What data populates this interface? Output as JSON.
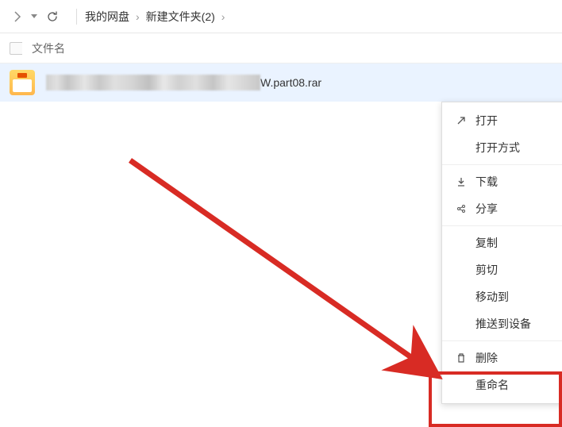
{
  "topbar": {
    "breadcrumbs": [
      "我的网盘",
      "新建文件夹(2)"
    ]
  },
  "columns": {
    "filename_label": "文件名"
  },
  "file": {
    "visible_suffix": "W.part08.rar"
  },
  "context_menu": {
    "open": "打开",
    "open_with": "打开方式",
    "download": "下载",
    "share": "分享",
    "copy": "复制",
    "cut": "剪切",
    "move_to": "移动到",
    "push_to_device": "推送到设备",
    "delete": "删除",
    "rename": "重命名"
  }
}
